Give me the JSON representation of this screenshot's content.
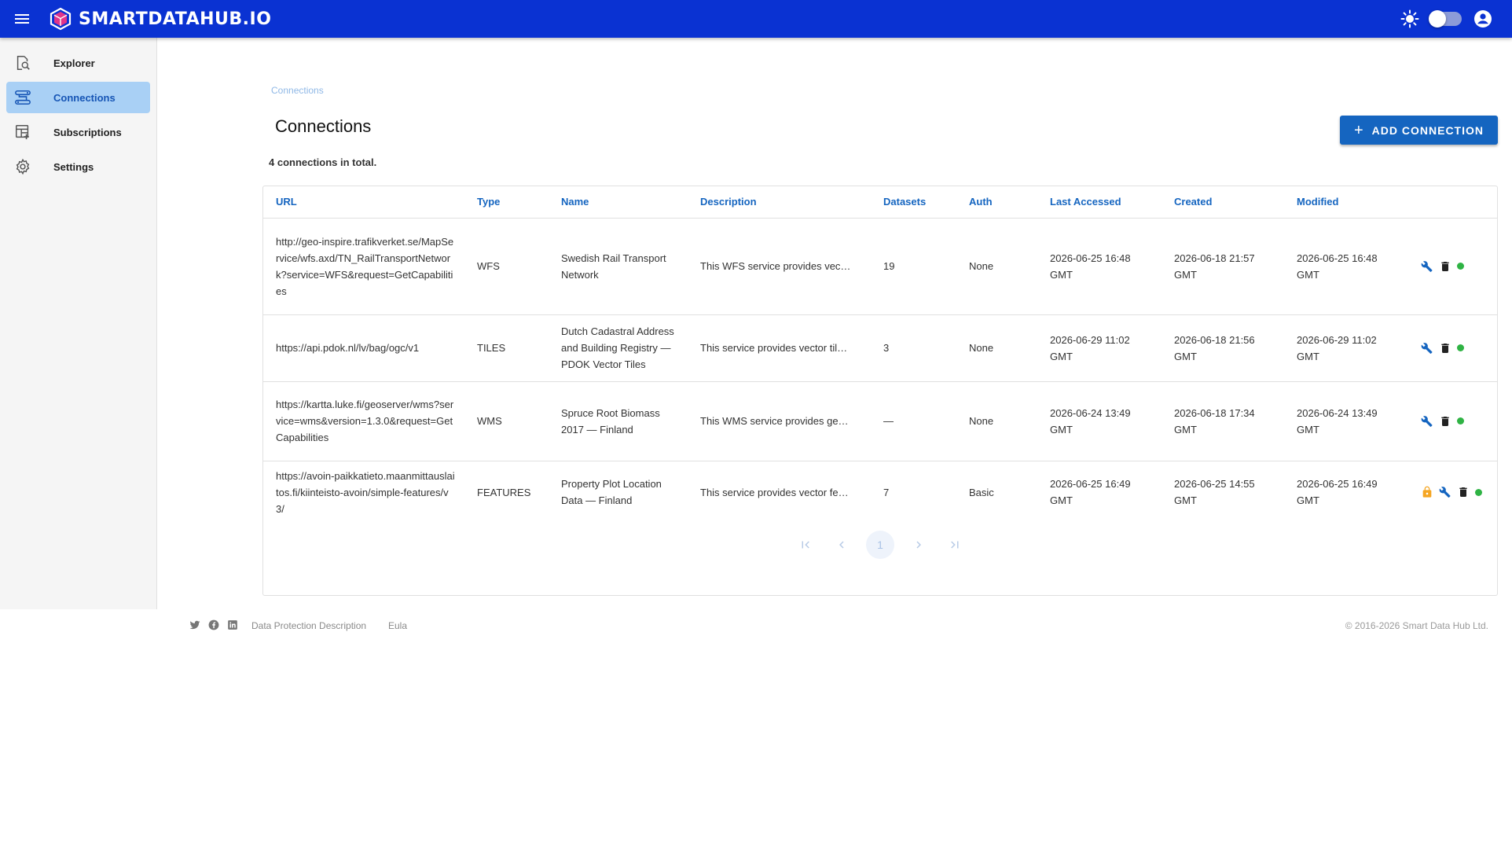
{
  "header": {
    "brand": "SMARTDATAHUB.IO",
    "accent": "#0a32d2"
  },
  "sidebar": {
    "items": [
      {
        "label": "Explorer",
        "icon": "explorer-icon"
      },
      {
        "label": "Connections",
        "icon": "connections-icon",
        "active": true
      },
      {
        "label": "Subscriptions",
        "icon": "subscriptions-icon"
      },
      {
        "label": "Settings",
        "icon": "gear-icon"
      }
    ]
  },
  "main": {
    "breadcrumb": "Connections",
    "title": "Connections",
    "add_button": "ADD CONNECTION",
    "total_text": "4 connections in total."
  },
  "table": {
    "columns": [
      "URL",
      "Type",
      "Name",
      "Description",
      "Datasets",
      "Auth",
      "Last Accessed",
      "Created",
      "Modified"
    ],
    "rows": [
      {
        "url": "http://geo-inspire.trafikverket.se/MapService/wfs.axd/TN_RailTransportNetwork?service=WFS&request=GetCapabilities",
        "type": "WFS",
        "name": "Swedish Rail Transport Network",
        "description": "This WFS service provides vec…",
        "datasets": "19",
        "auth": "None",
        "last_accessed": "2026-06-25 16:48 GMT",
        "created": "2026-06-18 21:57 GMT",
        "modified": "2026-06-25 16:48 GMT",
        "locked": false
      },
      {
        "url": "https://api.pdok.nl/lv/bag/ogc/v1",
        "type": "TILES",
        "name": "Dutch Cadastral Address and Building Registry — PDOK Vector Tiles",
        "description": "This service provides vector til…",
        "datasets": "3",
        "auth": "None",
        "last_accessed": "2026-06-29 11:02 GMT",
        "created": "2026-06-18 21:56 GMT",
        "modified": "2026-06-29 11:02 GMT",
        "locked": false
      },
      {
        "url": "https://kartta.luke.fi/geoserver/wms?service=wms&version=1.3.0&request=GetCapabilities",
        "type": "WMS",
        "name": "Spruce Root Biomass 2017 — Finland",
        "description": "This WMS service provides ge…",
        "datasets": "—",
        "auth": "None",
        "last_accessed": "2026-06-24 13:49 GMT",
        "created": "2026-06-18 17:34 GMT",
        "modified": "2026-06-24 13:49 GMT",
        "locked": false
      },
      {
        "url": "https://avoin-paikkatieto.maanmittauslaitos.fi/kiinteisto-avoin/simple-features/v3/",
        "type": "FEATURES",
        "name": "Property Plot Location Data — Finland",
        "description": "This service provides vector fe…",
        "datasets": "7",
        "auth": "Basic",
        "last_accessed": "2026-06-25 16:49 GMT",
        "created": "2026-06-25 14:55 GMT",
        "modified": "2026-06-25 16:49 GMT",
        "locked": true
      }
    ]
  },
  "pagination": {
    "current_page": "1"
  },
  "footer": {
    "links": [
      "Data Protection Description",
      "Eula"
    ],
    "copyright": "© 2016-2026 Smart Data Hub Ltd."
  }
}
